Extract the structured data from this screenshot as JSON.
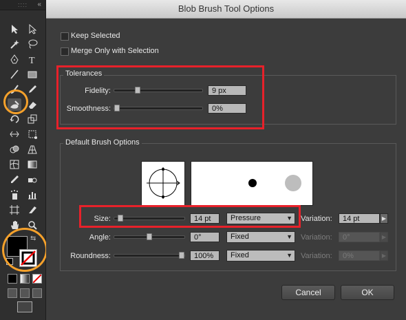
{
  "dialog": {
    "title": "Blob Brush Tool Options",
    "keep_selected": "Keep Selected",
    "merge_only": "Merge Only with Selection",
    "tolerances": {
      "title": "Tolerances",
      "fidelity_label": "Fidelity:",
      "fidelity_value": "9 px",
      "fidelity_level": 0.25,
      "smoothness_label": "Smoothness:",
      "smoothness_value": "0%",
      "smoothness_level": 0.0
    },
    "brush": {
      "title": "Default Brush Options",
      "size_label": "Size:",
      "size_value": "14 pt",
      "size_level": 0.05,
      "size_mode": "Pressure",
      "size_variation_label": "Variation:",
      "size_variation_value": "14 pt",
      "angle_label": "Angle:",
      "angle_value": "0°",
      "angle_level": 0.5,
      "angle_mode": "Fixed",
      "angle_variation_label": "Variation:",
      "angle_variation_value": "0°",
      "roundness_label": "Roundness:",
      "roundness_value": "100%",
      "roundness_level": 1.0,
      "roundness_mode": "Fixed",
      "roundness_variation_label": "Variation:",
      "roundness_variation_value": "0%"
    },
    "cancel_label": "Cancel",
    "ok_label": "OK"
  },
  "toolbar": {
    "collapse_glyph": "«",
    "tools": [
      "selection-tool",
      "direct-selection-tool",
      "magic-wand-tool",
      "lasso-tool",
      "pen-tool",
      "type-tool",
      "line-tool",
      "rectangle-tool",
      "paintbrush-tool",
      "pencil-tool",
      "blob-brush-tool",
      "eraser-tool",
      "rotate-tool",
      "scale-tool",
      "width-tool",
      "free-transform-tool",
      "shape-builder-tool",
      "perspective-grid-tool",
      "mesh-tool",
      "gradient-tool",
      "eyedropper-tool",
      "blend-tool",
      "symbol-sprayer-tool",
      "column-graph-tool",
      "artboard-tool",
      "slice-tool",
      "hand-tool",
      "zoom-tool"
    ]
  },
  "colors": {
    "highlight_circle": "#f5a12b",
    "highlight_box": "#e8212a"
  }
}
